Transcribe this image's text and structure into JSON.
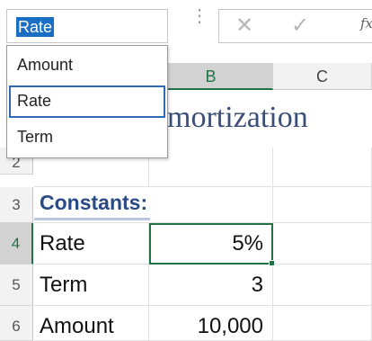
{
  "name_box": {
    "value": "Rate"
  },
  "formula_bar": {
    "cancel_icon": "close-icon",
    "enter_icon": "checkmark-icon",
    "fx_label": "fx"
  },
  "name_dropdown": {
    "items": [
      "Amount",
      "Rate",
      "Term"
    ],
    "focused_item": "Rate"
  },
  "columns": [
    "B",
    "C"
  ],
  "rows": [
    "2",
    "3",
    "4",
    "5",
    "6"
  ],
  "sheet": {
    "title": "mortization",
    "constants_heading": "Constants:",
    "rows": [
      {
        "label": "Rate",
        "value": "5%"
      },
      {
        "label": "Term",
        "value": "3"
      },
      {
        "label": "Amount",
        "value": "10,000"
      }
    ]
  },
  "colors": {
    "accent_green": "#217346",
    "selection_blue": "#1a6fc4",
    "heading_blue": "#2a4a86",
    "title_color": "#3a4e77"
  }
}
